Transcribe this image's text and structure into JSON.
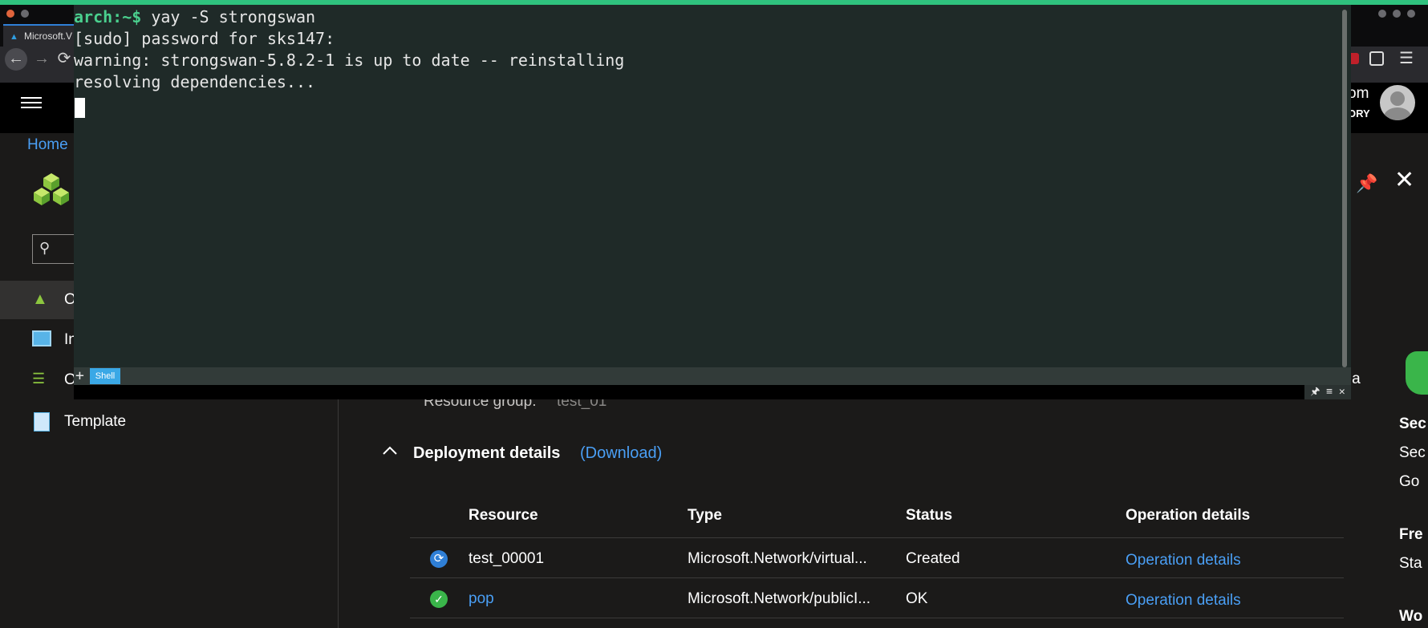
{
  "browser": {
    "tab_title": "Microsoft.V",
    "tab_icon": "azure-logo-icon"
  },
  "azure": {
    "header_right_text_1": "om",
    "header_right_text_2": "ORY",
    "breadcrumb": "Home",
    "left_nav": [
      {
        "label": "O",
        "icon": "overview-cubes-icon",
        "selected": true
      },
      {
        "label": "In",
        "icon": "inputs-monitor-icon",
        "selected": false
      },
      {
        "label": "O",
        "icon": "outputs-list-icon",
        "selected": false
      },
      {
        "label": "Template",
        "icon": "template-document-icon",
        "selected": false
      }
    ],
    "resource_group_label": "Resource group:",
    "resource_group_value": "test_01",
    "partial_right_text": "ada",
    "deployment_title": "Deployment details",
    "deployment_download": "(Download)",
    "table": {
      "headers": [
        "Resource",
        "Type",
        "Status",
        "Operation details"
      ],
      "rows": [
        {
          "status_icon": "refresh-icon",
          "resource": "test_00001",
          "resource_is_link": false,
          "type": "Microsoft.Network/virtual...",
          "status": "Created",
          "op": "Operation details"
        },
        {
          "status_icon": "check-circle-icon",
          "resource": "pop",
          "resource_is_link": true,
          "type": "Microsoft.Network/publicI...",
          "status": "OK",
          "op": "Operation details"
        }
      ]
    },
    "right_cut": [
      "Sec",
      "Sec",
      "Go",
      "Fre",
      "Sta",
      "Wo"
    ]
  },
  "terminal": {
    "prompt": "arch:~$",
    "command": " yay -S strongswan",
    "lines": [
      "[sudo] password for sks147:",
      "warning: strongswan-5.8.2-1 is up to date -- reinstalling",
      "resolving dependencies..."
    ],
    "tab_label": "Shell",
    "plus": "+",
    "controls": "🖈 ≡ ✕"
  },
  "colors": {
    "accent_green": "#2fc27e",
    "link_blue": "#4a9ff5",
    "terminal_bg": "#1f2a28",
    "prompt_green": "#4ad08e"
  }
}
